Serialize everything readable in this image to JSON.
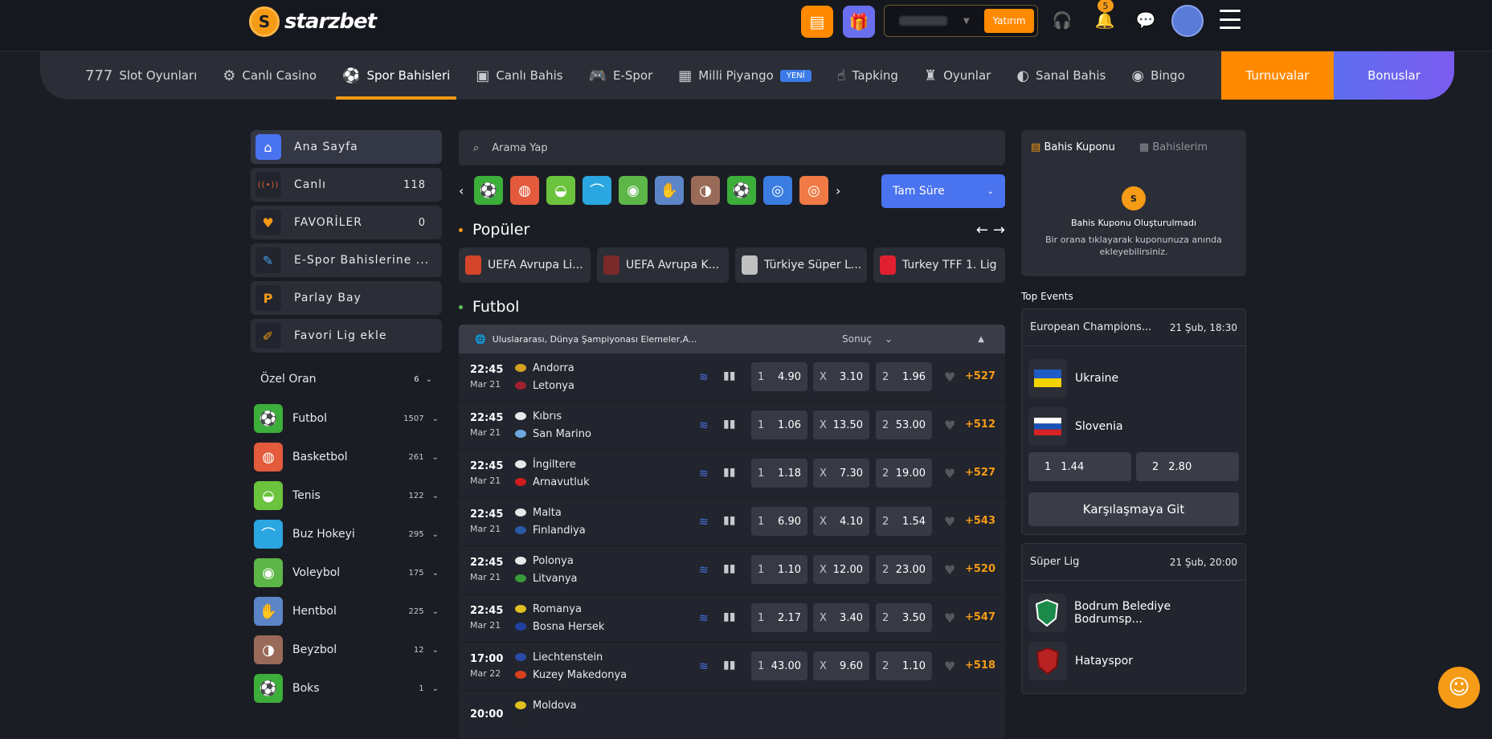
{
  "brand": {
    "name": "starzbet"
  },
  "header": {
    "deposit_label": "Yatırım",
    "notif_count": "5"
  },
  "nav": {
    "items": [
      {
        "label": "Slot Oyunları",
        "icon": "777"
      },
      {
        "label": "Canlı Casino",
        "icon": "⚙"
      },
      {
        "label": "Spor Bahisleri",
        "icon": "⚽"
      },
      {
        "label": "Canlı Bahis",
        "icon": "▣"
      },
      {
        "label": "E-Spor",
        "icon": "🎮"
      },
      {
        "label": "Milli Piyango",
        "icon": "▦"
      },
      {
        "label": "Tapking",
        "icon": "☝"
      },
      {
        "label": "Oyunlar",
        "icon": "♜"
      },
      {
        "label": "Sanal Bahis",
        "icon": "◐"
      },
      {
        "label": "Bingo",
        "icon": "◉"
      }
    ],
    "yeni": "YENİ",
    "turnuvalar": "Turnuvalar",
    "bonuslar": "Bonuslar"
  },
  "sidebar": {
    "buttons": [
      {
        "label": "Ana Sayfa",
        "count": "",
        "icon": "⌂"
      },
      {
        "label": "Canlı",
        "count": "118",
        "icon": "((•))"
      },
      {
        "label": "FAVORİLER",
        "count": "0",
        "icon": "♥"
      },
      {
        "label": "E-Spor Bahislerine ...",
        "count": "",
        "icon": "✎"
      },
      {
        "label": "Parlay Bay",
        "count": "",
        "icon": "P"
      },
      {
        "label": "Favori Lig ekle",
        "count": "",
        "icon": "✐"
      }
    ],
    "ozel": {
      "label": "Özel Oran",
      "count": "6"
    },
    "sports": [
      {
        "label": "Futbol",
        "count": "1507",
        "icon": "⚽",
        "color": "#3cae3a"
      },
      {
        "label": "Basketbol",
        "count": "261",
        "icon": "◍",
        "color": "#e35b3c"
      },
      {
        "label": "Tenis",
        "count": "122",
        "icon": "◒",
        "color": "#6cc33e"
      },
      {
        "label": "Buz Hokeyi",
        "count": "295",
        "icon": "⌒",
        "color": "#2aa6e0"
      },
      {
        "label": "Voleybol",
        "count": "175",
        "icon": "◉",
        "color": "#5cb648"
      },
      {
        "label": "Hentbol",
        "count": "225",
        "icon": "✋",
        "color": "#5c85c8"
      },
      {
        "label": "Beyzbol",
        "count": "12",
        "icon": "◑",
        "color": "#9a6a58"
      },
      {
        "label": "Boks",
        "count": "1",
        "icon": "⚽",
        "color": "#3cae3a"
      }
    ]
  },
  "center": {
    "search_placeholder": "Arama Yap",
    "sport_tiles": [
      {
        "icon": "⚽",
        "color": "#3cae3a"
      },
      {
        "icon": "◍",
        "color": "#e35b3c"
      },
      {
        "icon": "◒",
        "color": "#6cc33e"
      },
      {
        "icon": "⌒",
        "color": "#2aa6e0"
      },
      {
        "icon": "◉",
        "color": "#5cb648"
      },
      {
        "icon": "✋",
        "color": "#5c85c8"
      },
      {
        "icon": "◑",
        "color": "#9a6a58"
      },
      {
        "icon": "⚽",
        "color": "#3cae3a"
      },
      {
        "icon": "◎",
        "color": "#3a7ce0"
      },
      {
        "icon": "◎",
        "color": "#f07a45"
      }
    ],
    "period": "Tam Süre",
    "popular_title": "Popüler",
    "leagues": [
      {
        "label": "UEFA Avrupa Li...",
        "color": "#d5452a"
      },
      {
        "label": "UEFA Avrupa K...",
        "color": "#7a2a2a"
      },
      {
        "label": "Türkiye Süper L...",
        "color": "#c0c0c0"
      },
      {
        "label": "Turkey TFF 1. Lig",
        "color": "#e02030"
      }
    ],
    "football_title": "Futbol",
    "table_title": "Uluslararası, Dünya Şampiyonası Elemeler,A...",
    "result_label": "Sonuç",
    "matches": [
      {
        "time": "22:45",
        "date": "Mar 21",
        "home": "Andorra",
        "away": "Letonya",
        "o1": "4.90",
        "ox": "3.10",
        "o2": "1.96",
        "more": "+527",
        "hc": "#d4a020",
        "ac": "#a02030"
      },
      {
        "time": "22:45",
        "date": "Mar 21",
        "home": "Kıbrıs",
        "away": "San Marino",
        "o1": "1.06",
        "ox": "13.50",
        "o2": "53.00",
        "more": "+512",
        "hc": "#e8e8e8",
        "ac": "#6fa8e0"
      },
      {
        "time": "22:45",
        "date": "Mar 21",
        "home": "İngiltere",
        "away": "Arnavutluk",
        "o1": "1.18",
        "ox": "7.30",
        "o2": "19.00",
        "more": "+527",
        "hc": "#e8e8e8",
        "ac": "#d01c1c"
      },
      {
        "time": "22:45",
        "date": "Mar 21",
        "home": "Malta",
        "away": "Finlandiya",
        "o1": "6.90",
        "ox": "4.10",
        "o2": "1.54",
        "more": "+543",
        "hc": "#e8e8e8",
        "ac": "#2a5aa8"
      },
      {
        "time": "22:45",
        "date": "Mar 21",
        "home": "Polonya",
        "away": "Litvanya",
        "o1": "1.10",
        "ox": "12.00",
        "o2": "23.00",
        "more": "+520",
        "hc": "#e8e8e8",
        "ac": "#3a9a3a"
      },
      {
        "time": "22:45",
        "date": "Mar 21",
        "home": "Romanya",
        "away": "Bosna Hersek",
        "o1": "2.17",
        "ox": "3.40",
        "o2": "3.50",
        "more": "+547",
        "hc": "#e0c020",
        "ac": "#2040a0"
      },
      {
        "time": "17:00",
        "date": "Mar 22",
        "home": "Liechtenstein",
        "away": "Kuzey Makedonya",
        "o1": "43.00",
        "ox": "9.60",
        "o2": "1.10",
        "more": "+518",
        "hc": "#2a4aa8",
        "ac": "#d84020"
      },
      {
        "time": "20:00",
        "date": "",
        "home": "Moldova",
        "away": "",
        "o1": "",
        "ox": "",
        "o2": "",
        "more": "",
        "hc": "#e0c020",
        "ac": "#22252d"
      }
    ]
  },
  "coupon": {
    "tab_active": "Bahis Kuponu",
    "tab_other": "Bahislerim",
    "empty_title": "Bahis Kuponu Oluşturulmadı",
    "empty_text": "Bir orana tıklayarak kuponunuza anında ekleyebilirsiniz."
  },
  "top_events": {
    "title": "Top Events",
    "events": [
      {
        "league": "European Champions...",
        "date": "21 Şub, 18:30",
        "home": "Ukraine",
        "away": "Slovenia",
        "o1": "1.44",
        "o2": "2.80",
        "go": "Karşılaşmaya Git"
      },
      {
        "league": "Süper Lig",
        "date": "21 Şub, 20:00",
        "home": "Bodrum Belediye Bodrumsp...",
        "away": "Hatayspor"
      }
    ]
  }
}
